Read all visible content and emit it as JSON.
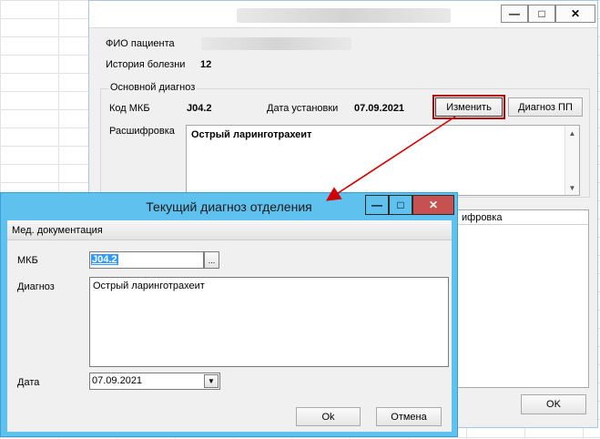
{
  "back_window": {
    "controls": {
      "minimize": "—",
      "maximize": "□",
      "close": "✕"
    },
    "patient_fio_label": "ФИО пациента",
    "history_label": "История болезни",
    "history_value": "12",
    "group_title": "Основной диагноз",
    "code_label": "Код МКБ",
    "code_value": "J04.2",
    "date_label": "Дата установки",
    "date_value": "07.09.2021",
    "change_button": "Изменить",
    "pp_button": "Диагноз ПП",
    "decoding_label": "Расшифровка",
    "decoding_value": "Острый ларинготрахеит",
    "table_header": "ифровка",
    "ok_button": "OK"
  },
  "dialog": {
    "title": "Текущий диагноз отделения",
    "controls": {
      "minimize": "—",
      "maximize": "□",
      "close": "✕"
    },
    "section": "Мед. документация",
    "mkb_label": "МКБ",
    "mkb_value": "J04.2",
    "mkb_lookup_button": "...",
    "diagnosis_label": "Диагноз",
    "diagnosis_value": "Острый ларинготрахеит",
    "date_label": "Дата",
    "date_value": "07.09.2021",
    "ok_button": "Ok",
    "cancel_button": "Отмена"
  },
  "colors": {
    "dialog_titlebar": "#5fc1ee",
    "close_button": "#c75050",
    "highlight_outline": "#b80000",
    "annotation_arrow": "#d00000",
    "selection": "#3399ff"
  },
  "icons": {
    "scroll_up": "chevron-up-icon",
    "scroll_down": "chevron-down-icon",
    "dropdown": "caret-down-icon",
    "annotation": "arrow-icon"
  }
}
